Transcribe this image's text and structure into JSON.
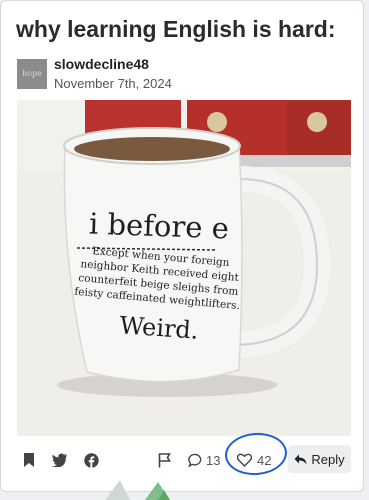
{
  "post": {
    "title": "why learning English is hard:",
    "author": "slowdecline48",
    "avatar_text": "hope",
    "date": "November 7th, 2024"
  },
  "mug": {
    "headline": "i before e",
    "line1": "Except when your foreign",
    "line2": "neighbor Keith received eight",
    "line3": "counterfeit beige sleighs from",
    "line4": "feisty caffeinated weightlifters.",
    "footer": "Weird."
  },
  "actions": {
    "comments_count": "13",
    "likes_count": "42",
    "reply_label": "Reply"
  },
  "colors": {
    "annotation_circle": "#1f5fd6"
  }
}
